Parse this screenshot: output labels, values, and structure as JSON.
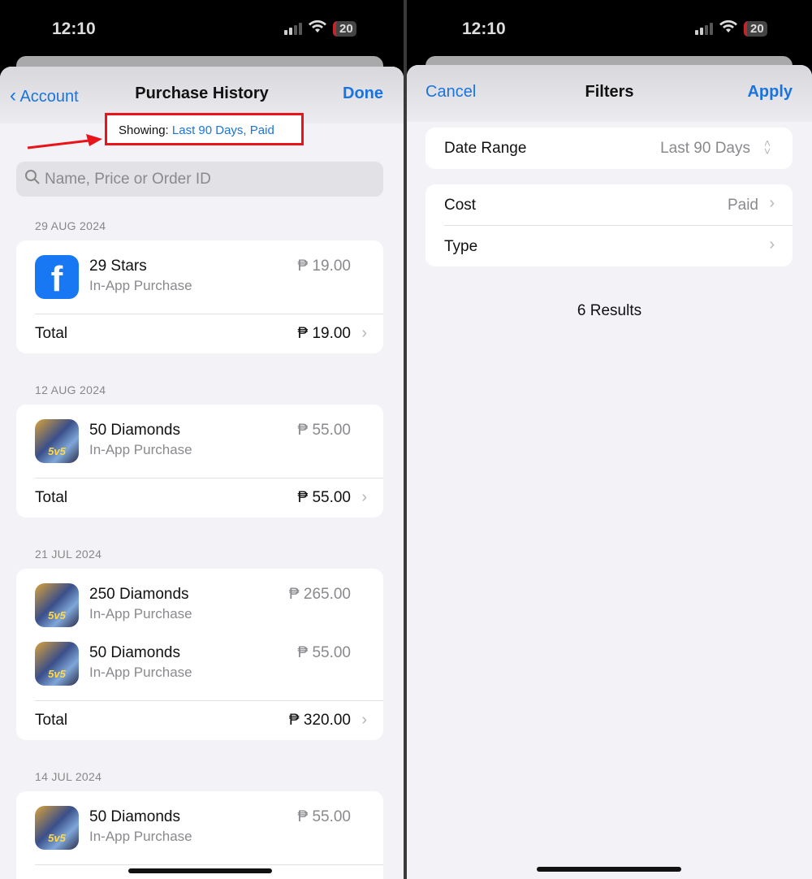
{
  "status_bar": {
    "time": "12:10",
    "battery": "20"
  },
  "left": {
    "nav": {
      "back_label": "Account",
      "title": "Purchase History",
      "done_label": "Done"
    },
    "filter_summary": {
      "prefix": "Showing:",
      "value": "Last 90 Days, Paid"
    },
    "search": {
      "placeholder": "Name, Price or Order ID"
    },
    "total_label": "Total",
    "groups": [
      {
        "date": "29 AUG 2024",
        "items": [
          {
            "name": "29 Stars",
            "type": "In-App Purchase",
            "price": "₱ 19.00",
            "icon": "facebook-icon"
          }
        ],
        "total": "₱ 19.00"
      },
      {
        "date": "12 AUG 2024",
        "items": [
          {
            "name": "50 Diamonds",
            "type": "In-App Purchase",
            "price": "₱ 55.00",
            "icon": "game-icon"
          }
        ],
        "total": "₱ 55.00"
      },
      {
        "date": "21 JUL 2024",
        "items": [
          {
            "name": "250 Diamonds",
            "type": "In-App Purchase",
            "price": "₱ 265.00",
            "icon": "game-icon"
          },
          {
            "name": "50 Diamonds",
            "type": "In-App Purchase",
            "price": "₱ 55.00",
            "icon": "game-icon"
          }
        ],
        "total": "₱ 320.00"
      },
      {
        "date": "14 JUL 2024",
        "items": [
          {
            "name": "50 Diamonds",
            "type": "In-App Purchase",
            "price": "₱ 55.00",
            "icon": "game-icon"
          }
        ]
      }
    ],
    "game_icon_text": "5v5",
    "facebook_icon_text": "f"
  },
  "right": {
    "nav": {
      "cancel_label": "Cancel",
      "title": "Filters",
      "apply_label": "Apply"
    },
    "date_range": {
      "label": "Date Range",
      "value": "Last 90 Days"
    },
    "cost": {
      "label": "Cost",
      "value": "Paid"
    },
    "type": {
      "label": "Type"
    },
    "results": "6 Results"
  },
  "colors": {
    "accent": "#1a74e0",
    "highlight": "#e8141a"
  }
}
